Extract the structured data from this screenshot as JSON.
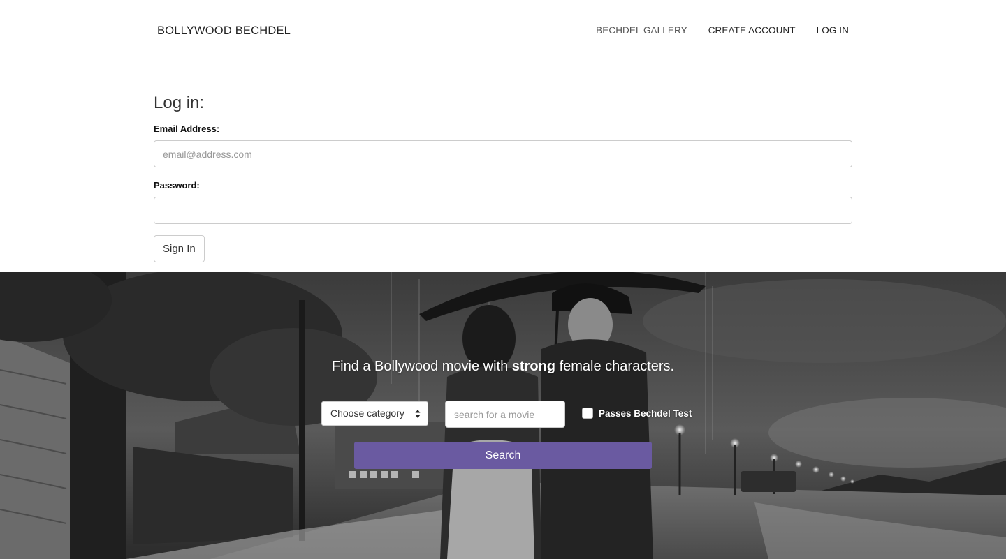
{
  "navbar": {
    "brand": "BOLLYWOOD BECHDEL",
    "links": [
      {
        "label": "BECHDEL GALLERY"
      },
      {
        "label": "CREATE ACCOUNT"
      },
      {
        "label": "LOG IN"
      }
    ]
  },
  "login": {
    "title": "Log in:",
    "email_label": "Email Address:",
    "email_placeholder": "email@address.com",
    "email_value": "",
    "password_label": "Password:",
    "password_value": "",
    "submit_label": "Sign In"
  },
  "hero": {
    "tagline_before": "Find a Bollywood movie with ",
    "tagline_strong": "strong",
    "tagline_after": " female characters.",
    "category_selected": "Choose category",
    "search_placeholder": "search for a movie",
    "search_value": "",
    "checkbox_label": "Passes Bechdel Test",
    "checkbox_checked": false,
    "search_button_label": "Search"
  },
  "colors": {
    "accent": "#6a5aa1",
    "text": "#222222",
    "border": "#cccccc"
  }
}
